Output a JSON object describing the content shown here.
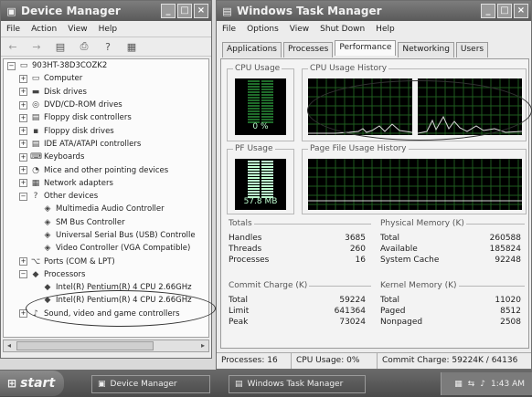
{
  "device_manager": {
    "title": "Device Manager",
    "menu": [
      "File",
      "Action",
      "View",
      "Help"
    ],
    "tree": [
      {
        "label": "903HT-38D3COZK2",
        "icon": "computer-icon",
        "depth": 0,
        "expander": "−"
      },
      {
        "label": "Computer",
        "icon": "computer-icon",
        "depth": 1,
        "expander": "+"
      },
      {
        "label": "Disk drives",
        "icon": "disk-icon",
        "depth": 1,
        "expander": "+"
      },
      {
        "label": "DVD/CD-ROM drives",
        "icon": "cdrom-icon",
        "depth": 1,
        "expander": "+"
      },
      {
        "label": "Floppy disk controllers",
        "icon": "controller-icon",
        "depth": 1,
        "expander": "+"
      },
      {
        "label": "Floppy disk drives",
        "icon": "floppy-icon",
        "depth": 1,
        "expander": "+"
      },
      {
        "label": "IDE ATA/ATAPI controllers",
        "icon": "controller-icon",
        "depth": 1,
        "expander": "+"
      },
      {
        "label": "Keyboards",
        "icon": "keyboard-icon",
        "depth": 1,
        "expander": "+"
      },
      {
        "label": "Mice and other pointing devices",
        "icon": "mouse-icon",
        "depth": 1,
        "expander": "+"
      },
      {
        "label": "Network adapters",
        "icon": "network-icon",
        "depth": 1,
        "expander": "+"
      },
      {
        "label": "Other devices",
        "icon": "question-icon",
        "depth": 1,
        "expander": "−"
      },
      {
        "label": "Multimedia Audio Controller",
        "icon": "unknown-device-icon",
        "depth": 2,
        "expander": ""
      },
      {
        "label": "SM Bus Controller",
        "icon": "unknown-device-icon",
        "depth": 2,
        "expander": ""
      },
      {
        "label": "Universal Serial Bus (USB) Controlle",
        "icon": "unknown-device-icon",
        "depth": 2,
        "expander": ""
      },
      {
        "label": "Video Controller (VGA Compatible)",
        "icon": "unknown-device-icon",
        "depth": 2,
        "expander": ""
      },
      {
        "label": "Ports (COM & LPT)",
        "icon": "port-icon",
        "depth": 1,
        "expander": "+"
      },
      {
        "label": "Processors",
        "icon": "processor-icon",
        "depth": 1,
        "expander": "−"
      },
      {
        "label": "Intel(R) Pentium(R) 4 CPU 2.66GHz",
        "icon": "processor-icon",
        "depth": 2,
        "expander": ""
      },
      {
        "label": "Intel(R) Pentium(R) 4 CPU 2.66GHz",
        "icon": "processor-icon",
        "depth": 2,
        "expander": ""
      },
      {
        "label": "Sound, video and game controllers",
        "icon": "sound-icon",
        "depth": 1,
        "expander": "+"
      }
    ]
  },
  "task_manager": {
    "title": "Windows Task Manager",
    "menu": [
      "File",
      "Options",
      "View",
      "Shut Down",
      "Help"
    ],
    "tabs": [
      {
        "label": "Applications",
        "active": false
      },
      {
        "label": "Processes",
        "active": false
      },
      {
        "label": "Performance",
        "active": true
      },
      {
        "label": "Networking",
        "active": false
      },
      {
        "label": "Users",
        "active": false
      }
    ],
    "cpu_usage": {
      "label": "CPU Usage",
      "value": "0 %",
      "level": 0
    },
    "cpu_history": {
      "label": "CPU Usage History"
    },
    "pf_usage": {
      "label": "PF Usage",
      "value": "57.8 MB"
    },
    "pf_history": {
      "label": "Page File Usage History"
    },
    "totals": {
      "label": "Totals",
      "rows": [
        {
          "k": "Handles",
          "v": "3685"
        },
        {
          "k": "Threads",
          "v": "260"
        },
        {
          "k": "Processes",
          "v": "16"
        }
      ]
    },
    "physical_memory": {
      "label": "Physical Memory (K)",
      "rows": [
        {
          "k": "Total",
          "v": "260588"
        },
        {
          "k": "Available",
          "v": "185824"
        },
        {
          "k": "System Cache",
          "v": "92248"
        }
      ]
    },
    "commit_charge": {
      "label": "Commit Charge (K)",
      "rows": [
        {
          "k": "Total",
          "v": "59224"
        },
        {
          "k": "Limit",
          "v": "641364"
        },
        {
          "k": "Peak",
          "v": "73024"
        }
      ]
    },
    "kernel_memory": {
      "label": "Kernel Memory (K)",
      "rows": [
        {
          "k": "Total",
          "v": "11020"
        },
        {
          "k": "Paged",
          "v": "8512"
        },
        {
          "k": "Nonpaged",
          "v": "2508"
        }
      ]
    },
    "status": {
      "processes": "Processes: 16",
      "cpu": "CPU Usage: 0%",
      "commit": "Commit Charge: 59224K / 64136"
    }
  },
  "taskbar": {
    "start": "start",
    "tasks": [
      "Device Manager",
      "Windows Task Manager"
    ],
    "clock": "1:43 AM"
  },
  "colors": {
    "meter_green": "#bdfccf",
    "grid_green": "#1e5a1e",
    "titlebar": "#5a5a5a"
  }
}
